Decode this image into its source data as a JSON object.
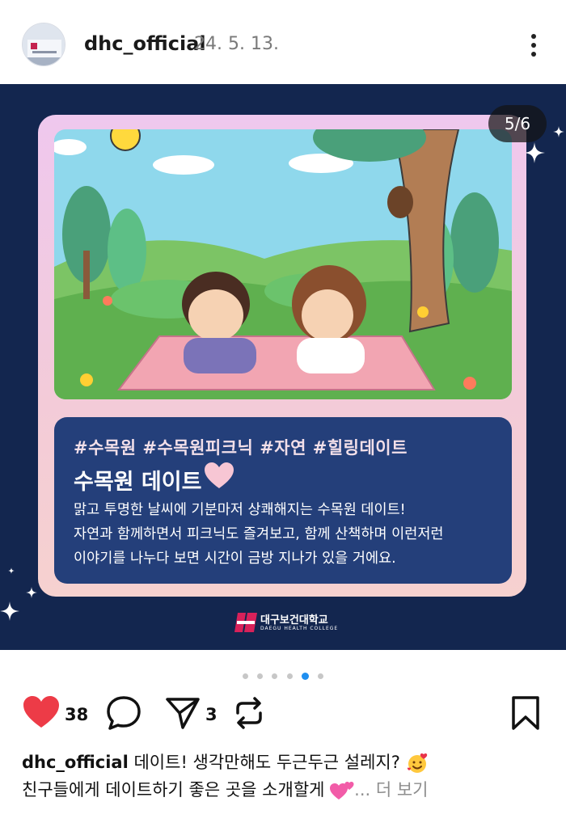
{
  "header": {
    "username": "dhc_official",
    "date": "24. 5. 13.",
    "avatar_text": "대구보건대학교"
  },
  "post": {
    "counter": "5/6",
    "card": {
      "hashtags": "#수목원 #수목원피크닉 #자연 #힐링데이트",
      "title": "수목원 데이트",
      "body_lines": [
        "맑고 투명한 날씨에 기분마저 상쾌해지는 수목원 데이트!",
        "자연과 함께하면서 피크닉도 즐겨보고, 함께 산책하며 이런저런",
        "이야기를 나누다 보면 시간이 금방 지나가 있을 거에요."
      ]
    },
    "logo": {
      "name": "대구보건대학교",
      "subtitle": "DAEGU HEALTH COLLEGE"
    }
  },
  "carousel": {
    "total": 6,
    "active_index": 4,
    "active_color": "#1f8ff0"
  },
  "actions": {
    "like_count": "38",
    "share_count": "3",
    "like_color": "#ed3b47",
    "icons": [
      "heart-icon",
      "comment-icon",
      "send-icon",
      "repost-icon",
      "bookmark-icon"
    ]
  },
  "caption": {
    "username": "dhc_official",
    "line1": "데이트! 생각만해도 두근두근 설레지?",
    "line2": "친구들에게 데이트하기 좋은 곳을 소개할게",
    "more": "... 더 보기"
  },
  "colors": {
    "background_navy": "#13264f",
    "textbox_blue": "#243f7a",
    "card_pink": "#f3cbd8"
  }
}
